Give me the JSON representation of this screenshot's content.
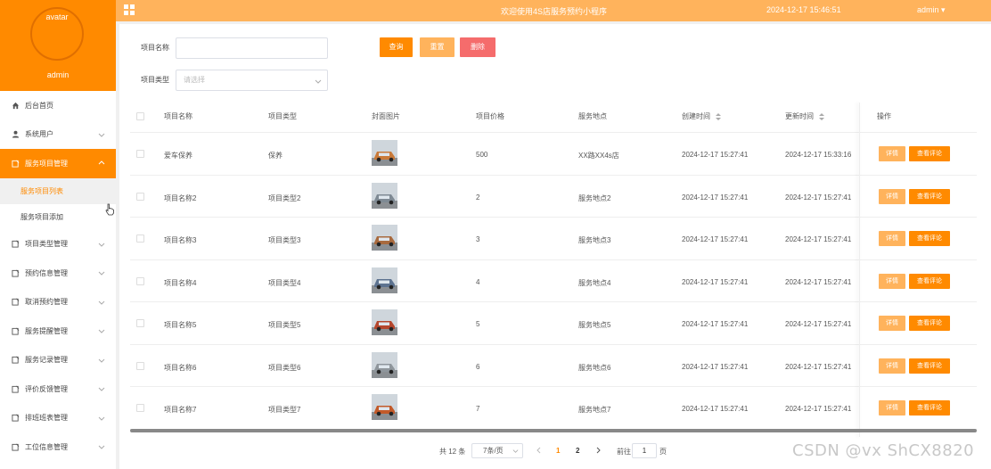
{
  "sidebar": {
    "avatar_label": "avatar",
    "admin_name": "admin",
    "menu": [
      {
        "label": "后台首页"
      },
      {
        "label": "系统用户"
      },
      {
        "label": "服务项目管理"
      },
      {
        "label": "项目类型管理"
      },
      {
        "label": "预约信息管理"
      },
      {
        "label": "取消预约管理"
      },
      {
        "label": "服务提醒管理"
      },
      {
        "label": "服务记录管理"
      },
      {
        "label": "评价反馈管理"
      },
      {
        "label": "排班班表管理"
      },
      {
        "label": "工位信息管理"
      }
    ],
    "submenu": [
      {
        "label": "服务项目列表"
      },
      {
        "label": "服务项目添加"
      }
    ]
  },
  "topbar": {
    "welcome": "欢迎使用4S店服务预约小程序",
    "datetime": "2024-12-17 15:46:51",
    "user": "admin ▾"
  },
  "search": {
    "name_label": "项目名称",
    "name_value": "",
    "type_label": "项目类型",
    "type_placeholder": "请选择",
    "query_button": "查询",
    "reset_button": "重置",
    "delete_button": "删除"
  },
  "table": {
    "headers": {
      "name": "项目名称",
      "type": "项目类型",
      "image": "封面图片",
      "price": "项目价格",
      "location": "服务地点",
      "created": "创建时间",
      "updated": "更新时间",
      "actions": "操作"
    },
    "detail_label": "详情",
    "review_label": "查看评论",
    "rows": [
      {
        "name": "爱车保养",
        "type": "保养",
        "price": "500",
        "location": "XX路XX4s店",
        "created": "2024-12-17 15:27:41",
        "updated": "2024-12-17 15:33:16",
        "image_color": "#c97a3a"
      },
      {
        "name": "项目名称2",
        "type": "项目类型2",
        "price": "2",
        "location": "服务地点2",
        "created": "2024-12-17 15:27:41",
        "updated": "2024-12-17 15:27:41",
        "image_color": "#7f8a94"
      },
      {
        "name": "项目名称3",
        "type": "项目类型3",
        "price": "3",
        "location": "服务地点3",
        "created": "2024-12-17 15:27:41",
        "updated": "2024-12-17 15:27:41",
        "image_color": "#a86a3e"
      },
      {
        "name": "项目名称4",
        "type": "项目类型4",
        "price": "4",
        "location": "服务地点4",
        "created": "2024-12-17 15:27:41",
        "updated": "2024-12-17 15:27:41",
        "image_color": "#5d7390"
      },
      {
        "name": "项目名称5",
        "type": "项目类型5",
        "price": "5",
        "location": "服务地点5",
        "created": "2024-12-17 15:27:41",
        "updated": "2024-12-17 15:27:41",
        "image_color": "#b5472e"
      },
      {
        "name": "项目名称6",
        "type": "项目类型6",
        "price": "6",
        "location": "服务地点6",
        "created": "2024-12-17 15:27:41",
        "updated": "2024-12-17 15:27:41",
        "image_color": "#8f969c"
      },
      {
        "name": "项目名称7",
        "type": "项目类型7",
        "price": "7",
        "location": "服务地点7",
        "created": "2024-12-17 15:27:41",
        "updated": "2024-12-17 15:27:41",
        "image_color": "#c25a2a"
      }
    ]
  },
  "pagination": {
    "total": "共 12 条",
    "page_size": "7条/页",
    "pages": [
      "1",
      "2"
    ],
    "current_page": "1",
    "goto_label": "前往",
    "goto_value": "1",
    "page_suffix": "页"
  },
  "watermark": "CSDN @vx ShCX8820"
}
